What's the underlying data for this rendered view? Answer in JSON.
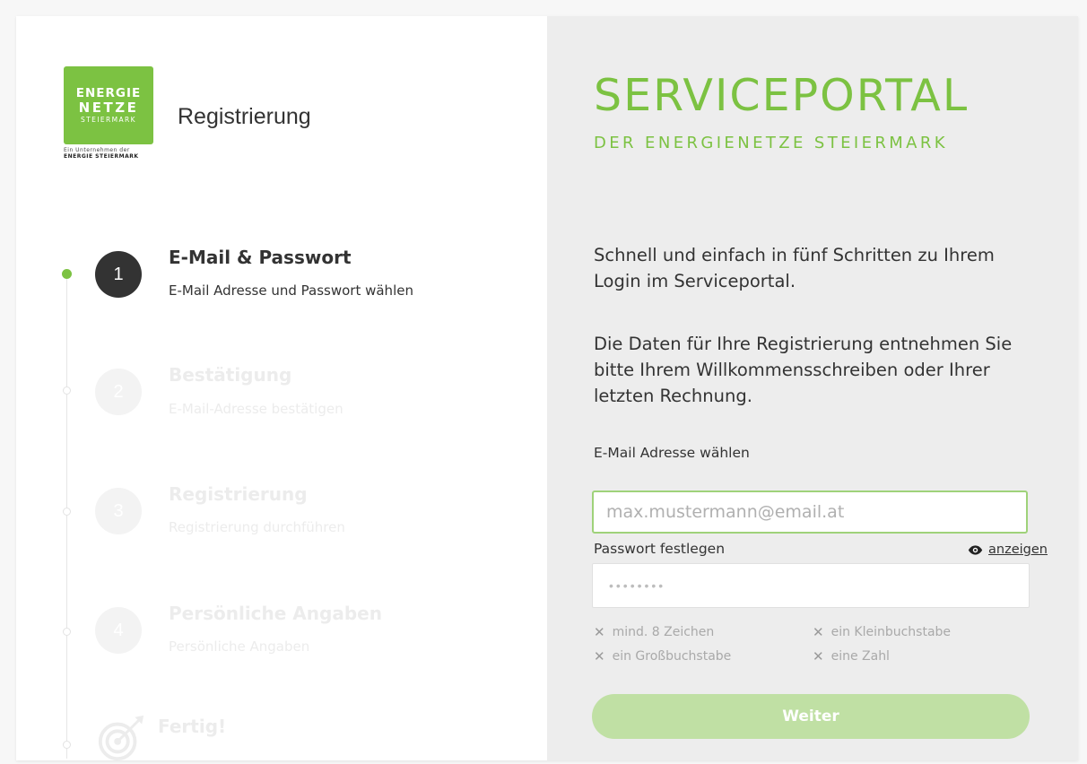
{
  "logo": {
    "line1": "ENERGIE",
    "line2": "NETZE",
    "line3": "STEIERMARK",
    "sub1": "Ein Unternehmen der",
    "sub2": "ENERGIE STEIERMARK",
    "brand_color": "#7cc242"
  },
  "left": {
    "title": "Registrierung",
    "steps": [
      {
        "number": "1",
        "title": "E-Mail & Passwort",
        "subtitle": "E-Mail Adresse und Passwort wählen",
        "state": "active"
      },
      {
        "number": "2",
        "title": "Bestätigung",
        "subtitle": "E-Mail-Adresse bestätigen",
        "state": "inactive"
      },
      {
        "number": "3",
        "title": "Registrierung",
        "subtitle": "Registrierung durchführen",
        "state": "inactive"
      },
      {
        "number": "4",
        "title": "Persönliche Angaben",
        "subtitle": "Persönliche Angaben",
        "state": "inactive"
      },
      {
        "number": "",
        "title": "Fertig!",
        "subtitle": "",
        "state": "inactive",
        "icon": "target-icon"
      }
    ]
  },
  "right": {
    "title": "SERVICEPORTAL",
    "subtitle": "DER ENERGIENETZE STEIERMARK",
    "intro1": "Schnell und einfach in fünf Schritten zu Ihrem Login im Serviceportal.",
    "intro2": "Die Daten für Ihre Registrierung entnehmen Sie bitte Ihrem Willkommensschreiben oder Ihrer letzten Rechnung.",
    "email_label": "E-Mail Adresse wählen",
    "email_placeholder": "max.mustermann@email.at",
    "email_value": "",
    "password_label": "Passwort festlegen",
    "password_placeholder": "••••••••",
    "show_label": "anzeigen",
    "rules": {
      "r1": "mind. 8 Zeichen",
      "r2": "ein Kleinbuchstabe",
      "r3": "ein Großbuchstabe",
      "r4": "eine Zahl"
    },
    "submit_label": "Weiter"
  }
}
